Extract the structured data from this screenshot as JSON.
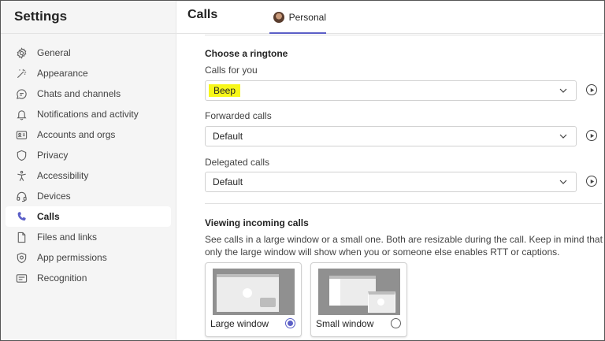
{
  "sidebar": {
    "title": "Settings",
    "items": [
      {
        "label": "General",
        "icon": "gear-icon"
      },
      {
        "label": "Appearance",
        "icon": "magic-wand-icon"
      },
      {
        "label": "Chats and channels",
        "icon": "chat-icon"
      },
      {
        "label": "Notifications and activity",
        "icon": "bell-icon"
      },
      {
        "label": "Accounts and orgs",
        "icon": "contact-card-icon"
      },
      {
        "label": "Privacy",
        "icon": "shield-icon"
      },
      {
        "label": "Accessibility",
        "icon": "accessibility-icon"
      },
      {
        "label": "Devices",
        "icon": "headset-icon"
      },
      {
        "label": "Calls",
        "icon": "phone-icon",
        "active": true
      },
      {
        "label": "Files and links",
        "icon": "document-icon"
      },
      {
        "label": "App permissions",
        "icon": "shield-check-icon"
      },
      {
        "label": "Recognition",
        "icon": "recognition-icon"
      }
    ]
  },
  "header": {
    "title": "Calls",
    "tab": "Personal"
  },
  "ringtone": {
    "heading": "Choose a ringtone",
    "calls_for_you": {
      "label": "Calls for you",
      "value": "Beep"
    },
    "forwarded": {
      "label": "Forwarded calls",
      "value": "Default"
    },
    "delegated": {
      "label": "Delegated calls",
      "value": "Default"
    }
  },
  "incoming": {
    "heading": "Viewing incoming calls",
    "description": "See calls in a large window or a small one. Both are resizable during the call. Keep in mind that only the large window will show when you or someone else enables RTT or captions.",
    "options": [
      {
        "label": "Large window",
        "selected": true
      },
      {
        "label": "Small window",
        "selected": false
      }
    ]
  },
  "colors": {
    "accent": "#5b5fc7",
    "highlight": "#f7f71a",
    "sidebar_bg": "#f5f5f5"
  }
}
